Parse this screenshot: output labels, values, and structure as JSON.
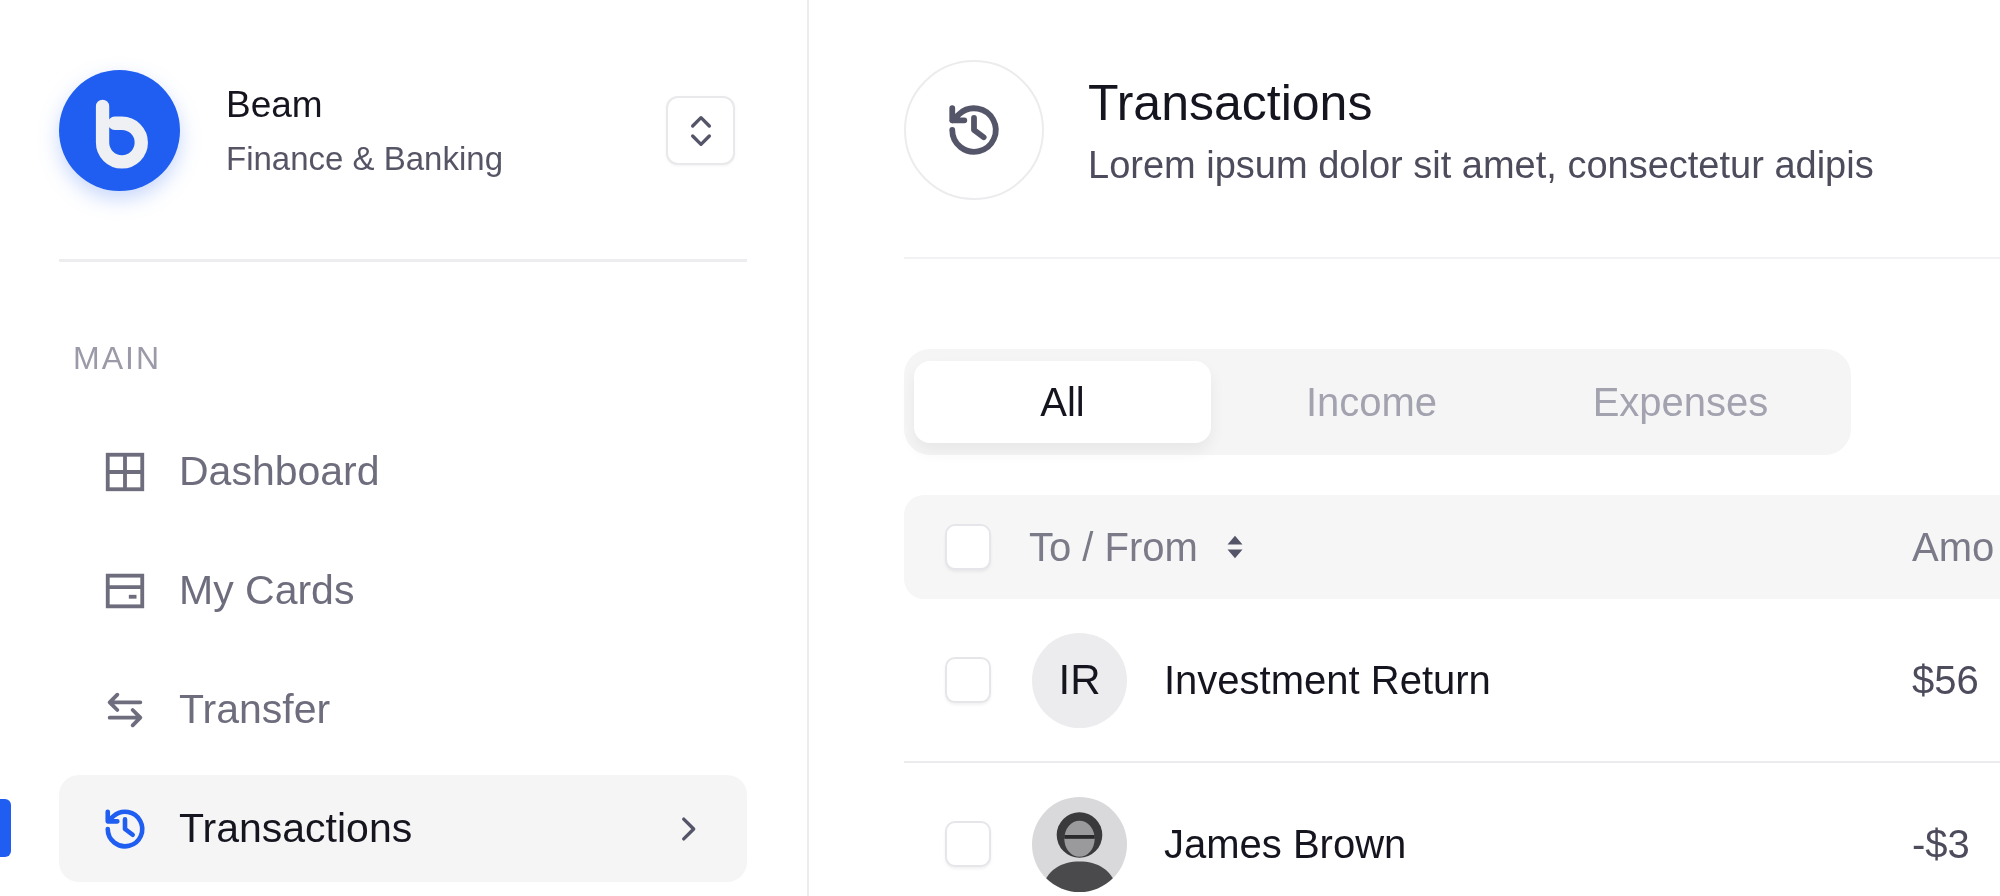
{
  "workspace": {
    "name": "Beam",
    "subtitle": "Finance & Banking"
  },
  "sidebar": {
    "section": "MAIN",
    "items": [
      {
        "label": "Dashboard",
        "kind": "grid",
        "selected": false
      },
      {
        "label": "My Cards",
        "kind": "card",
        "selected": false
      },
      {
        "label": "Transfer",
        "kind": "transfer",
        "selected": false
      },
      {
        "label": "Transactions",
        "kind": "history",
        "selected": true
      }
    ]
  },
  "header": {
    "title": "Transactions",
    "subtitle": "Lorem ipsum dolor sit amet, consectetur adipis"
  },
  "tabs": [
    {
      "label": "All",
      "selected": true
    },
    {
      "label": "Income",
      "selected": false
    },
    {
      "label": "Expenses",
      "selected": false
    }
  ],
  "table": {
    "checked": false,
    "columns": [
      {
        "label": "To / From",
        "sortable": true
      },
      {
        "label": "Amo",
        "sortable": false
      }
    ],
    "rows": [
      {
        "checked": false,
        "avatar": {
          "kind": "initials",
          "text": "IR"
        },
        "name": "Investment Return",
        "amount": "$56"
      },
      {
        "checked": false,
        "name": "James Brown",
        "amount": "-$3"
      }
    ]
  }
}
